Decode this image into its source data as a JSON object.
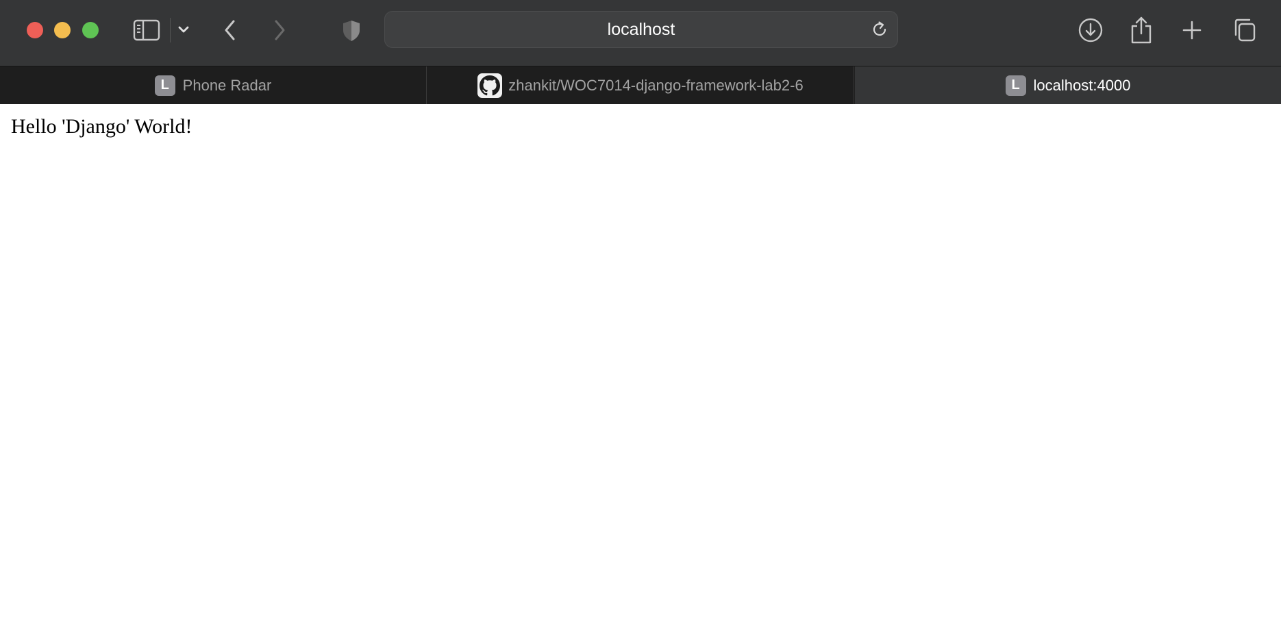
{
  "browser": {
    "address_bar": {
      "text": "localhost"
    },
    "icons": {
      "sidebar": "sidebar-icon",
      "sidebar_menu": "chevron-down-icon",
      "back": "chevron-left-icon",
      "forward": "chevron-right-icon",
      "privacy": "shield-icon",
      "reload": "reload-icon",
      "downloads": "download-icon",
      "share": "share-icon",
      "new_tab": "plus-icon",
      "tab_overview": "tabs-overview-icon"
    },
    "tabs": [
      {
        "label": "Phone Radar",
        "favicon_letter": "L",
        "active": false
      },
      {
        "label": "zhankit/WOC7014-django-framework-lab2-6",
        "favicon": "github-icon",
        "active": false
      },
      {
        "label": "localhost:4000",
        "favicon_letter": "L",
        "active": true
      }
    ]
  },
  "page": {
    "body_text": "Hello 'Django' World!"
  },
  "colors": {
    "toolbar_bg": "#353637",
    "tabbar_bg": "#1e1e1e",
    "active_tab_bg": "#353637",
    "close": "#ee5f57",
    "minimize": "#f4bd4f",
    "maximize": "#5fc454"
  }
}
